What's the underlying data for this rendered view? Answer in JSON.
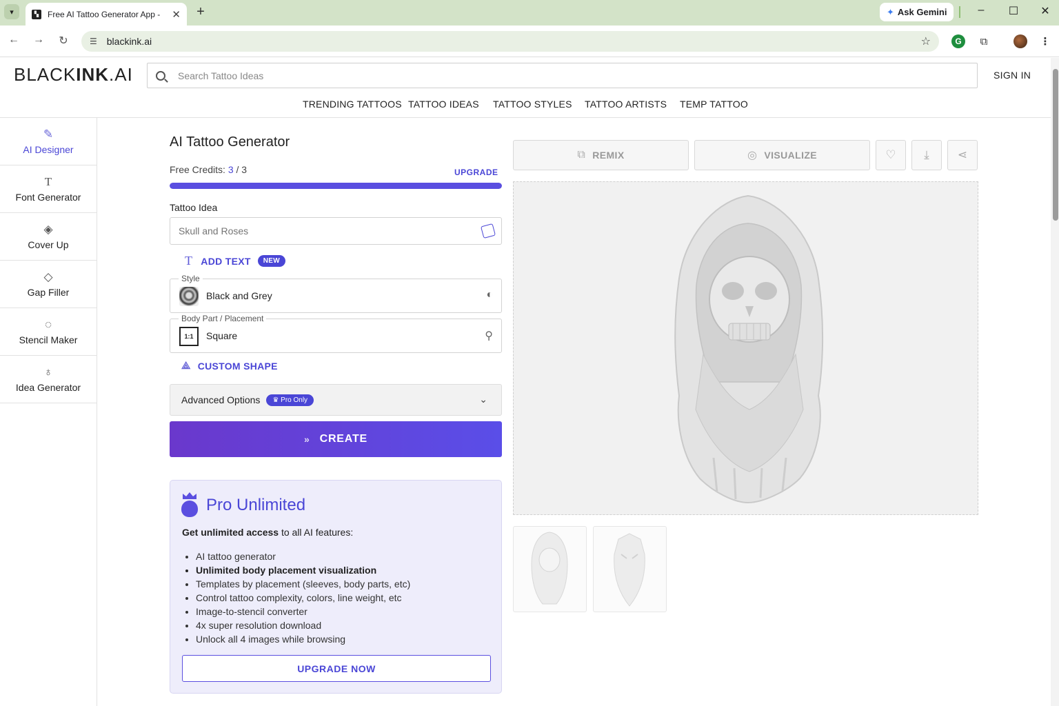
{
  "browser": {
    "tab_title": "Free AI Tattoo Generator App -",
    "url": "blackink.ai",
    "gemini_label": "Ask Gemini"
  },
  "site": {
    "logo_light": "BLACK",
    "logo_bold": "INK",
    "logo_suffix": ".AI",
    "search_placeholder": "Search Tattoo Ideas",
    "sign_in": "SIGN IN",
    "nav": [
      "TRENDING TATTOOS",
      "TATTOO IDEAS",
      "TATTOO STYLES",
      "TATTOO ARTISTS",
      "TEMP TATTOO"
    ]
  },
  "sidebar": {
    "items": [
      {
        "label": "AI Designer",
        "icon": "pen-nib-icon",
        "active": true
      },
      {
        "label": "Font Generator",
        "icon": "text-icon"
      },
      {
        "label": "Cover Up",
        "icon": "layers-icon"
      },
      {
        "label": "Gap Filler",
        "icon": "paint-bucket-icon"
      },
      {
        "label": "Stencil Maker",
        "icon": "dashed-circle-icon"
      },
      {
        "label": "Idea Generator",
        "icon": "lightbulb-icon"
      }
    ]
  },
  "generator": {
    "title": "AI Tattoo Generator",
    "credits_label": "Free Credits:",
    "credits_used": "3",
    "credits_sep": "/",
    "credits_total": "3",
    "credits_fraction": 1.0,
    "upgrade_link": "UPGRADE",
    "idea_label": "Tattoo Idea",
    "idea_placeholder": "Skull and Roses",
    "add_text": "ADD TEXT",
    "new_badge": "NEW",
    "style_caption": "Style",
    "style_value": "Black and Grey",
    "placement_caption": "Body Part / Placement",
    "placement_value": "Square",
    "placement_thumb": "1:1",
    "custom_shape": "CUSTOM SHAPE",
    "advanced_label": "Advanced Options",
    "pro_only_badge": "Pro Only",
    "create_label": "CREATE"
  },
  "pro_card": {
    "title": "Pro Unlimited",
    "lead_bold": "Get unlimited access",
    "lead_rest": " to all AI features:",
    "features": [
      {
        "text": "AI tattoo generator",
        "bold": false
      },
      {
        "text": "Unlimited body placement visualization",
        "bold": true
      },
      {
        "text": "Templates by placement (sleeves, body parts, etc)",
        "bold": false
      },
      {
        "text": "Control tattoo complexity, colors, line weight, etc",
        "bold": false
      },
      {
        "text": "Image-to-stencil converter",
        "bold": false
      },
      {
        "text": "4x super resolution download",
        "bold": false
      },
      {
        "text": "Unlock all 4 images while browsing",
        "bold": false
      }
    ],
    "upgrade_button": "UPGRADE NOW"
  },
  "preview": {
    "remix_label": "REMIX",
    "visualize_label": "VISUALIZE",
    "icons": [
      "heart-icon",
      "download-icon",
      "share-icon"
    ]
  },
  "colors": {
    "accent": "#4a46d6",
    "create_gradient_start": "#6a38cc",
    "create_gradient_end": "#5a4ee8",
    "pro_bg": "#eeedfb",
    "browser_frame": "#d3e3c8"
  }
}
